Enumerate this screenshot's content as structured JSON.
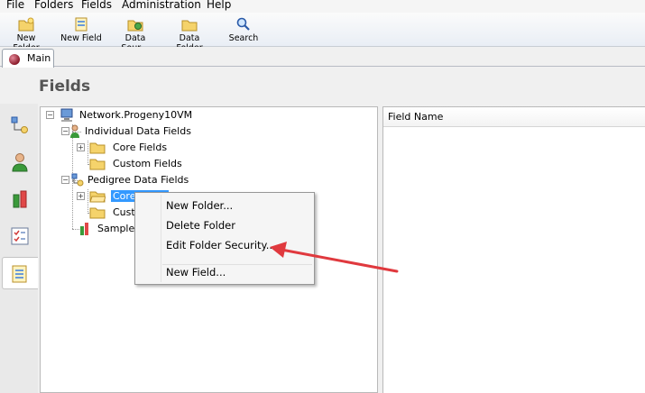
{
  "menu": [
    "File",
    "Folders",
    "Fields",
    "Administration",
    "Help"
  ],
  "toolbar": {
    "new_folder": "New Folder",
    "new_field": "New Field",
    "data_source": "Data Sour…",
    "data_folder": "Data Folder",
    "search": "Search"
  },
  "tab": {
    "label": "Main"
  },
  "page_title": "Fields",
  "tree": {
    "root": "Network.Progeny10VM",
    "individual": "Individual Data Fields",
    "ind_core": "Core Fields",
    "ind_custom": "Custom Fields",
    "pedigree": "Pedigree Data Fields",
    "ped_core": "Core Fields",
    "ped_custom": "Custom Fields",
    "sample": "Sample Data Fields"
  },
  "right_pane": {
    "column_header": "Field Name"
  },
  "context_menu": {
    "new_folder": "New Folder...",
    "delete_folder": "Delete Folder",
    "edit_security": "Edit Folder Security...",
    "new_field": "New Field..."
  },
  "colors": {
    "selection": "#3399ff",
    "arrow": "#e0393e",
    "folder": "#f5d36b"
  }
}
